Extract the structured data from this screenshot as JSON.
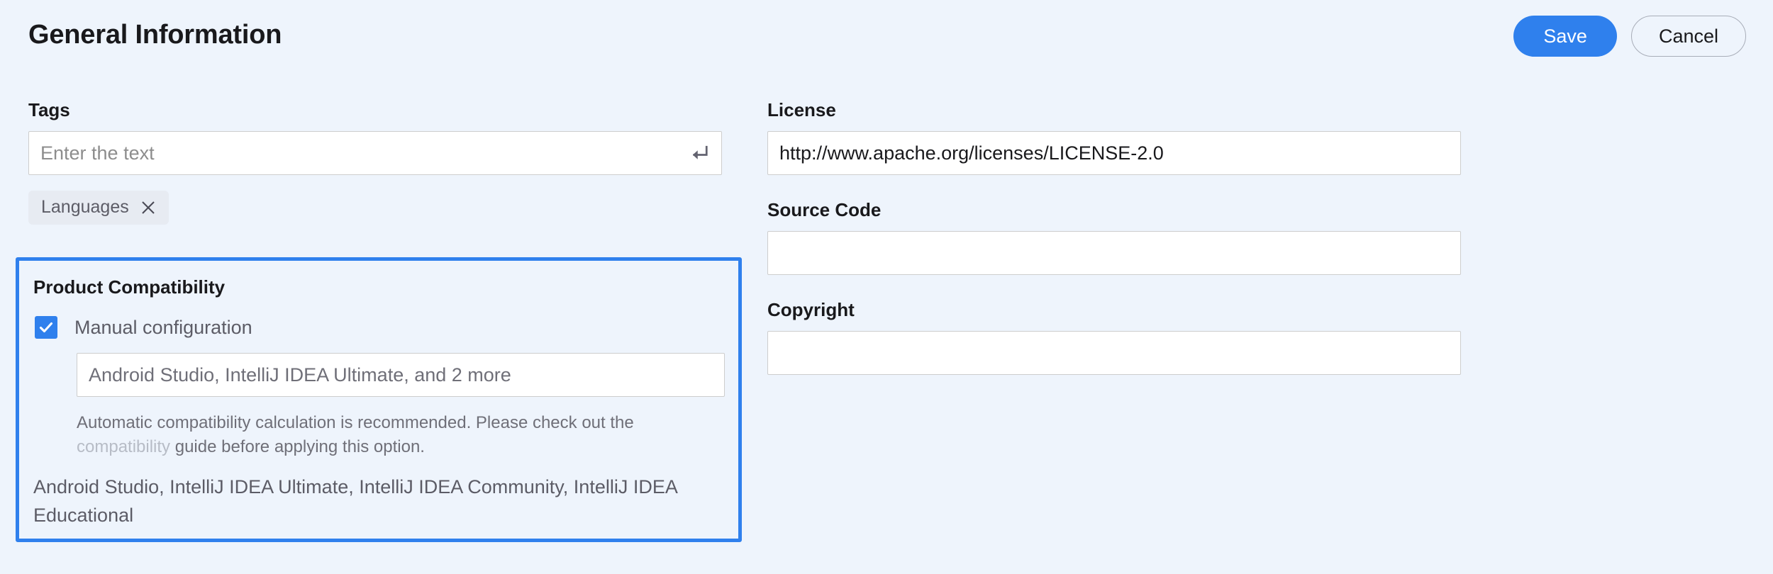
{
  "header": {
    "title": "General Information",
    "save_label": "Save",
    "cancel_label": "Cancel",
    "save_color": "#2f80ed"
  },
  "left_column": {
    "tags": {
      "label": "Tags",
      "placeholder": "Enter the text",
      "value": "",
      "submit_icon": "enter-return-icon",
      "chips": [
        {
          "label": "Languages",
          "close_icon": "close-icon"
        }
      ]
    },
    "product_compatibility": {
      "title": "Product Compatibility",
      "highlighted": true,
      "highlight_color": "#2f80ed",
      "checkbox": {
        "label": "Manual configuration",
        "checked": true,
        "icon": "checkmark-icon"
      },
      "selection_value": "Android Studio, IntelliJ IDEA Ultimate, and 2 more",
      "help_text_before_link": "Automatic compatibility calculation is recommended. Please check out the ",
      "help_link_text": "compatibility",
      "help_text_after_link": " guide before applying this option.",
      "products_summary": "Android Studio, IntelliJ IDEA Ultimate, IntelliJ IDEA Community, IntelliJ IDEA Educational"
    }
  },
  "right_column": {
    "license": {
      "label": "License",
      "value": "http://www.apache.org/licenses/LICENSE-2.0",
      "placeholder": ""
    },
    "source_code": {
      "label": "Source Code",
      "value": "",
      "placeholder": ""
    },
    "copyright": {
      "label": "Copyright",
      "value": "",
      "placeholder": ""
    }
  }
}
